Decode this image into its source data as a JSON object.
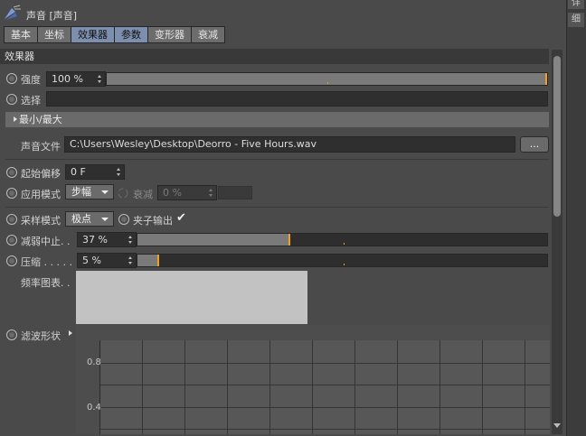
{
  "window": {
    "title": "声音 [声音]"
  },
  "tabs": [
    {
      "label": "基本",
      "selected": false
    },
    {
      "label": "坐标",
      "selected": false
    },
    {
      "label": "效果器",
      "selected": true
    },
    {
      "label": "参数",
      "selected": true
    },
    {
      "label": "变形器",
      "selected": false
    },
    {
      "label": "衰减",
      "selected": false
    }
  ],
  "side_tabs": [
    "详",
    "细"
  ],
  "section": {
    "title": "效果器"
  },
  "strength": {
    "label": "强度",
    "value": "100 %",
    "fraction": 1.0
  },
  "selection": {
    "label": "选择",
    "value": ""
  },
  "minmax_group": {
    "label": "最小/最大"
  },
  "sound_file": {
    "label": "声音文件",
    "value": "C:\\Users\\Wesley\\Desktop\\Deorro - Five Hours.wav",
    "browse_label": "..."
  },
  "start_offset": {
    "label": "起始偏移",
    "value": "0 F"
  },
  "apply_mode": {
    "label": "应用模式",
    "value": "步幅",
    "falloff_label": "衰减",
    "falloff_value": "0 %"
  },
  "sample_mode": {
    "label": "采样模式",
    "value": "极点",
    "clamp_label": "夹子输出",
    "clamp_checked": true
  },
  "decay": {
    "label": "减弱中止. .",
    "value": "37 %",
    "fraction": 0.37
  },
  "compress": {
    "label": "压缩 . . . . .",
    "value": "5 %",
    "fraction": 0.05
  },
  "frequency_graph": {
    "label": "频率图表. ."
  },
  "filter_shape": {
    "label": "滤波形状",
    "y_ticks": [
      "0.8",
      "0.4"
    ]
  },
  "colors": {
    "accent": "#f0a020",
    "selected_tab": "#7d8fae"
  }
}
